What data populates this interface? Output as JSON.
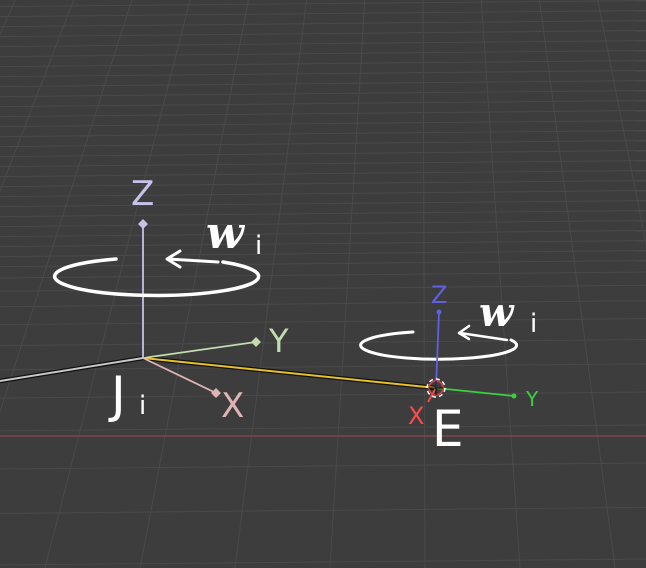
{
  "viewport": {
    "background": "#3d3d3d",
    "grid_color": "#4a4a4a",
    "horizon_line_color": "#8a4a52"
  },
  "joint_j": {
    "name_main": "J",
    "name_sub": "i",
    "rotation_symbol": "w",
    "rotation_sub": "i",
    "axes": {
      "x": "X",
      "y": "Y",
      "z": "Z"
    },
    "colors": {
      "x": "#e0b4b4",
      "y": "#c2dcb0",
      "z": "#c6c2ea",
      "ring": "#ffffff"
    }
  },
  "effector_e": {
    "name": "E",
    "rotation_symbol": "w",
    "rotation_sub": "i",
    "axes": {
      "x": "X",
      "y": "Y",
      "z": "Z"
    },
    "colors": {
      "x": "#ff4a4a",
      "y": "#3cd040",
      "z": "#6060e0",
      "ring": "#ffffff"
    }
  },
  "link": {
    "fill_color": "#e8c028",
    "outline_color": "#111111",
    "tail_color": "#c8c8c8"
  },
  "icons": [
    "rotation-arrow-icon",
    "origin-target-icon"
  ]
}
